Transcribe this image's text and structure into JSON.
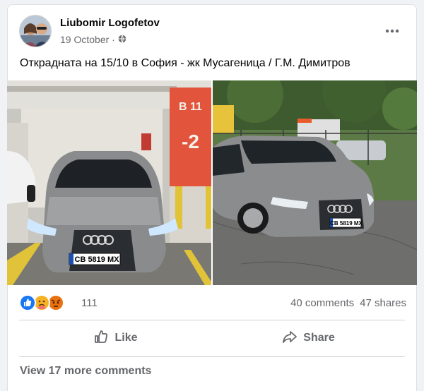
{
  "post": {
    "author": "Liubomir Logofetov",
    "date": "19 October ·",
    "privacy_icon": "globe-icon",
    "text": "Откраднатa на 15/10 в София - жк Мусагеница / Г.М. Димитров",
    "photos": [
      {
        "description_icon": "car-photo",
        "plate": "CB 5819 MX",
        "pillar": "B 11",
        "level": "-2"
      },
      {
        "description_icon": "car-photo",
        "plate": "CB 5819 MX"
      }
    ]
  },
  "reactions": {
    "icons": [
      "like-icon",
      "care-icon",
      "angry-icon"
    ],
    "count": "111",
    "comments": "40 comments",
    "shares": "47 shares"
  },
  "actions": {
    "like": "Like",
    "share": "Share"
  },
  "comments": {
    "view_more": "View 17 more comments"
  },
  "colors": {
    "like_blue": "#1877f2",
    "angry": "#e9710f",
    "care": "#f7b125",
    "text_muted": "#65676b"
  }
}
